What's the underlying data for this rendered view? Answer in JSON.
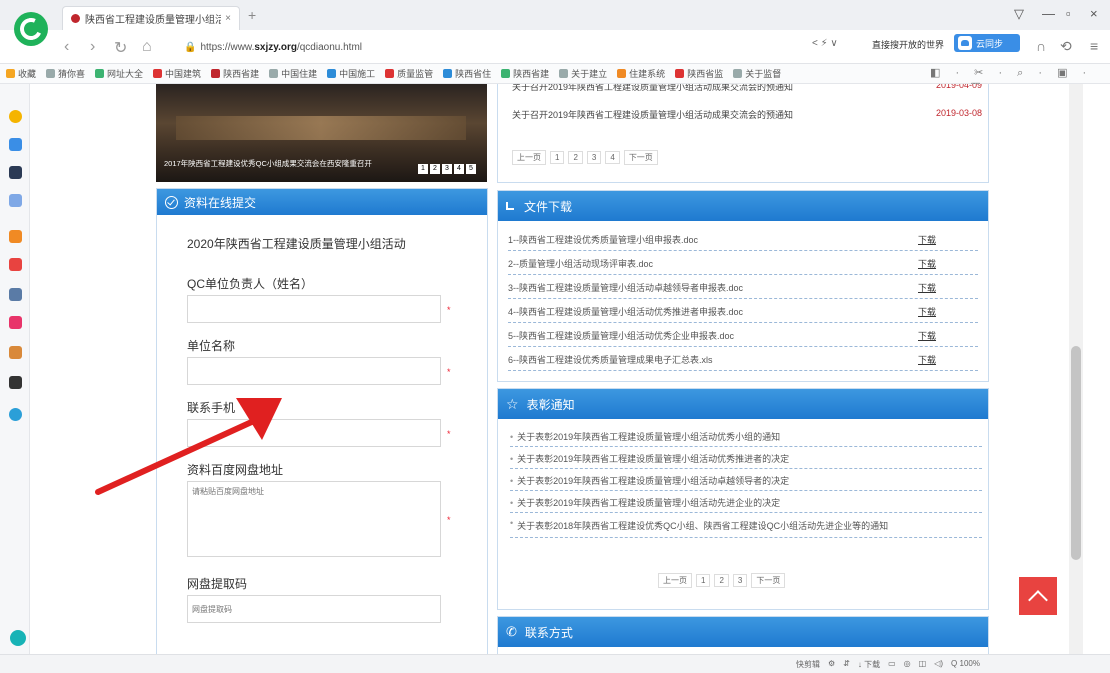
{
  "browser": {
    "tab_title": "陕西省工程建设质量管理小组活动",
    "tab_close": "×",
    "new_tab": "+",
    "window_controls": [
      "▽",
      "—",
      "▫",
      "×"
    ],
    "url_prefix": "https://www.",
    "url_host": "sxjzy.org",
    "url_path": "/qcdiaonu.html",
    "addr_right": "< ⚡ ∨",
    "search_text": "直接搜开放的世界",
    "cloud_label": "云同步",
    "bookmarks": [
      "收藏",
      "猜你喜",
      "网址大全",
      "中国建筑",
      "陕西省建",
      "中国住建",
      "中国施工",
      "质量监管",
      "陕西省住",
      "陕西省建",
      "关于建立",
      "住建系统",
      "陕西省监",
      "关于监督"
    ],
    "bookmark_tools": "◧ · ✂ · ⌕ · ▣ · ◐ · ▦"
  },
  "slider": {
    "caption": "2017年陕西省工程建设优秀QC小组成果交流会在西安隆重召开",
    "pages": [
      "1",
      "2",
      "3",
      "4",
      "5"
    ]
  },
  "form_panel": {
    "header": "资料在线提交",
    "title": "2020年陕西省工程建设质量管理小组活动",
    "fields": [
      {
        "label": "QC单位负责人（姓名）",
        "placeholder": ""
      },
      {
        "label": "单位名称",
        "placeholder": ""
      },
      {
        "label": "联系手机",
        "placeholder": ""
      },
      {
        "label": "资料百度网盘地址",
        "placeholder": "请粘贴百度网盘地址"
      },
      {
        "label": "网盘提取码",
        "placeholder": "网盘提取码"
      }
    ],
    "required_mark": "*"
  },
  "notices": {
    "rows": [
      {
        "title": "关于召开2019年陕西省工程建设质量管理小组活动成果交流会的预通知",
        "date": "2019-04-09"
      },
      {
        "title": "关于召开2019年陕西省工程建设质量管理小组活动成果交流会的预通知",
        "date": "2019-03-08"
      }
    ],
    "pager": [
      "上一页",
      "1",
      "2",
      "3",
      "4",
      "下一页"
    ]
  },
  "downloads": {
    "header": "文件下载",
    "link_label": "下载",
    "files": [
      "1--陕西省工程建设优秀质量管理小组申报表.doc",
      "2--质量管理小组活动现场评审表.doc",
      "3--陕西省工程建设质量管理小组活动卓越领导者申报表.doc",
      "4--陕西省工程建设质量管理小组活动优秀推进者申报表.doc",
      "5--陕西省工程建设质量管理小组活动优秀企业申报表.doc",
      "6--陕西省工程建设优秀质量管理成果电子汇总表.xls"
    ]
  },
  "awards": {
    "header": "表彰通知",
    "rows": [
      "关于表彰2019年陕西省工程建设质量管理小组活动优秀小组的通知",
      "关于表彰2019年陕西省工程建设质量管理小组活动优秀推进者的决定",
      "关于表彰2019年陕西省工程建设质量管理小组活动卓越领导者的决定",
      "关于表彰2019年陕西省工程建设质量管理小组活动先进企业的决定",
      "关于表彰2018年陕西省工程建设优秀QC小组、陕西省工程建设QC小组活动先进企业等的通知"
    ],
    "pager": [
      "上一页",
      "1",
      "2",
      "3",
      "下一页"
    ]
  },
  "contact": {
    "header": "联系方式"
  },
  "status_bar": [
    "快剪辑",
    "⚙",
    "⇵",
    "↓ 下载",
    "▭",
    "◎",
    "◫",
    "◁)",
    "Q 100%"
  ],
  "colors": {
    "panel_header": "#1f7ad0",
    "accent_red": "#e84340",
    "arrow": "#e02020"
  }
}
